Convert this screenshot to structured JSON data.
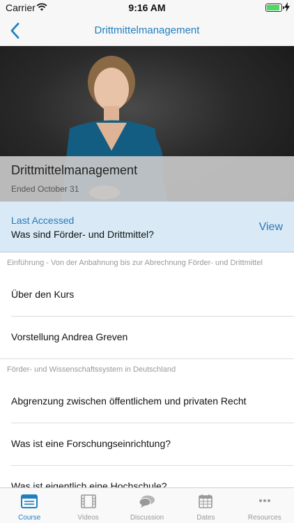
{
  "status_bar": {
    "carrier": "Carrier",
    "time": "9:16 AM",
    "battery_level": 0.9
  },
  "nav": {
    "title": "Drittmittelmanagement",
    "back_icon": "chevron-left-icon"
  },
  "course": {
    "title": "Drittmittelmanagement",
    "status": "Ended October 31"
  },
  "last_accessed": {
    "label": "Last Accessed",
    "item": "Was sind Förder- und Drittmittel?",
    "action": "View"
  },
  "sections": [
    {
      "header": "Einführung - Von der Anbahnung bis zur Abrechnung Förder- und Drittmittel",
      "items": [
        "Über den Kurs",
        "Vorstellung Andrea Greven"
      ]
    },
    {
      "header": "Förder- und Wissenschaftssystem in Deutschland",
      "items": [
        "Abgrenzung zwischen öffentlichem und privaten Recht",
        "Was ist eine Forschungseinrichtung?",
        "Was ist eigentlich eine Hochschule?"
      ]
    }
  ],
  "tabs": [
    {
      "label": "Course",
      "icon": "course-icon",
      "active": true
    },
    {
      "label": "Videos",
      "icon": "film-icon",
      "active": false
    },
    {
      "label": "Discussion",
      "icon": "chat-bubbles-icon",
      "active": false
    },
    {
      "label": "Dates",
      "icon": "calendar-icon",
      "active": false
    },
    {
      "label": "Resources",
      "icon": "more-dots-icon",
      "active": false
    }
  ],
  "colors": {
    "accent": "#1f7fbf",
    "last_accessed_bg": "#d9eaf6",
    "tab_inactive": "#999999"
  }
}
